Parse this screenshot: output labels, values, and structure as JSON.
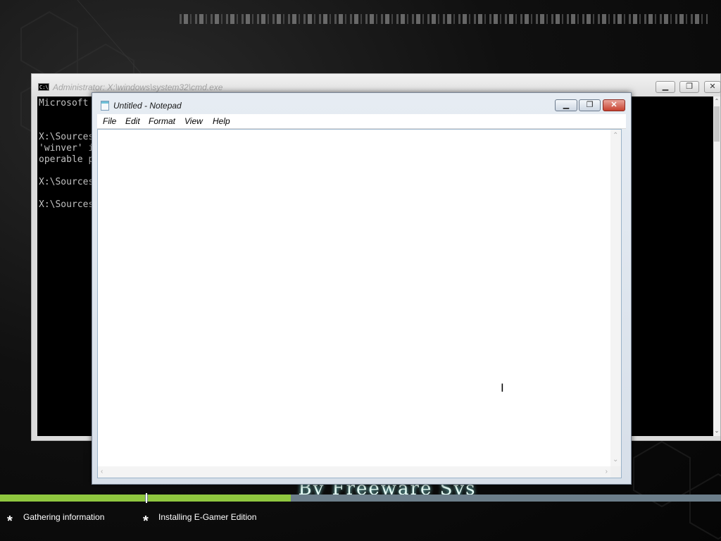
{
  "desktop": {
    "brand_text": "By Freeware Sys"
  },
  "cmd": {
    "title": "Administrator: X:\\windows\\system32\\cmd.exe",
    "icon_text": "C:\\",
    "minimize": "▁",
    "maximize": "❐",
    "close": "✕",
    "lines": [
      "Microsoft",
      "",
      "",
      "X:\\Sources",
      "'winver' i",
      "operable p",
      "",
      "X:\\Sources",
      "",
      "X:\\Sources"
    ]
  },
  "notepad": {
    "title": "Untitled - Notepad",
    "menu": [
      "File",
      "Edit",
      "Format",
      "View",
      "Help"
    ],
    "text": "",
    "minimize": "▁",
    "maximize": "❐",
    "close": "✕"
  },
  "setup_status": {
    "progress_percent": 40,
    "stages": [
      {
        "label": "Gathering information"
      },
      {
        "label": "Installing E-Gamer Edition"
      }
    ],
    "star": "*"
  },
  "colors": {
    "progress_fill": "#8fc73f",
    "progress_track": "#6c7e8a",
    "notepad_close": "#c7412f"
  },
  "icons": [
    "cmd-icon",
    "notepad-icon",
    "minimize-icon",
    "maximize-icon",
    "close-icon",
    "ibeam-cursor-icon"
  ]
}
